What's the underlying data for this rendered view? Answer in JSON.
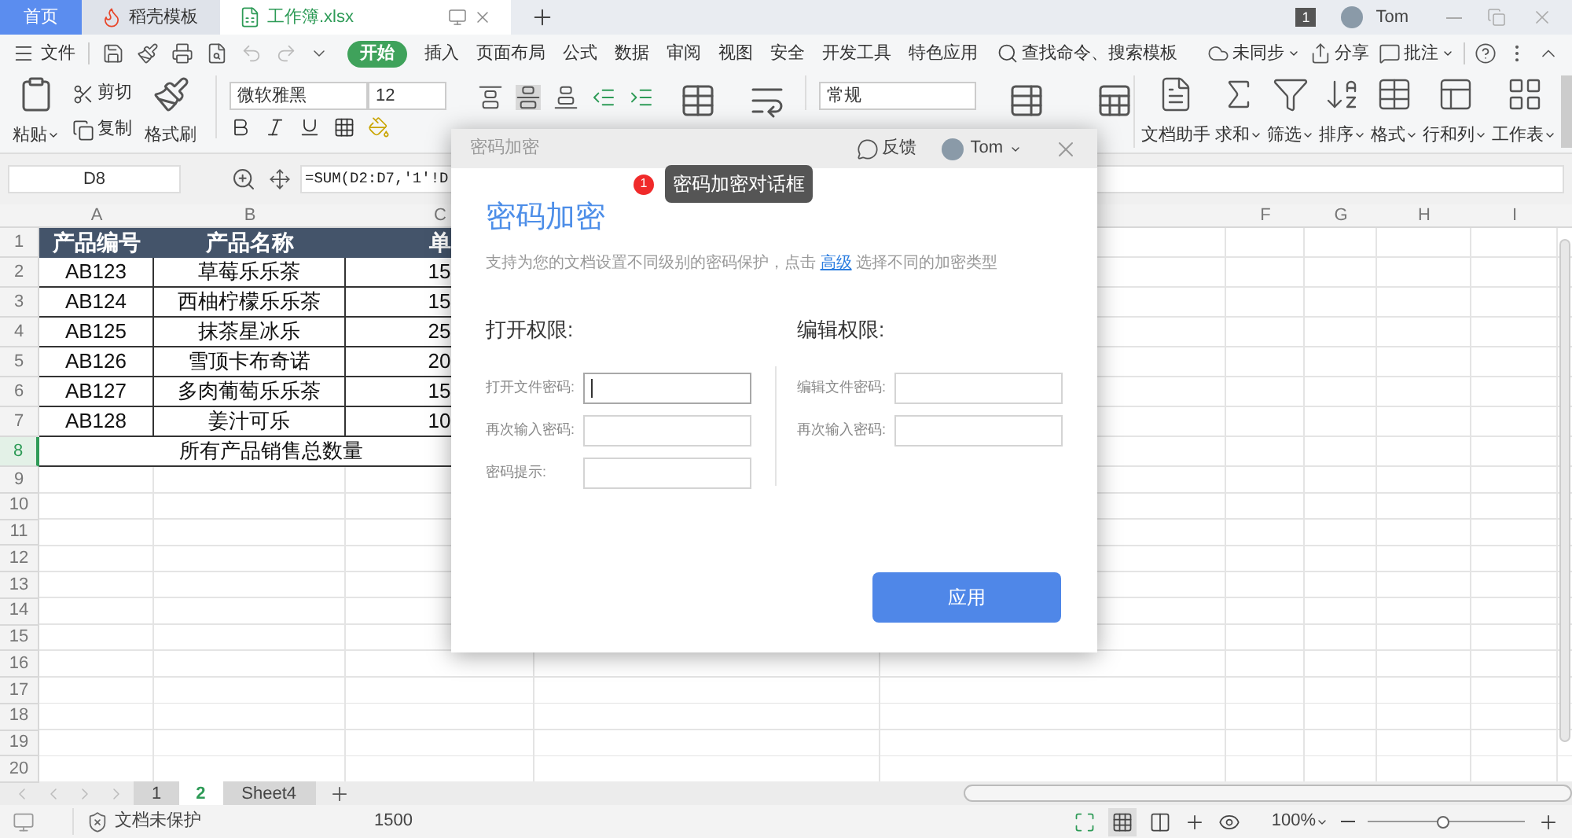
{
  "tabs": [
    {
      "label": "首页",
      "kind": "home",
      "selected": false
    },
    {
      "label": "稻壳模板",
      "kind": "docer",
      "selected": false
    },
    {
      "label": "工作簿.xlsx",
      "kind": "sheet",
      "selected": true
    }
  ],
  "title_bar": {
    "page_count": "1",
    "user": "Tom"
  },
  "menu": {
    "file": "文件",
    "items": [
      {
        "label": "开始",
        "selected": true
      },
      {
        "label": "插入",
        "selected": false
      },
      {
        "label": "页面布局",
        "selected": false
      },
      {
        "label": "公式",
        "selected": false
      },
      {
        "label": "数据",
        "selected": false
      },
      {
        "label": "审阅",
        "selected": false
      },
      {
        "label": "视图",
        "selected": false
      },
      {
        "label": "安全",
        "selected": false
      },
      {
        "label": "开发工具",
        "selected": false
      },
      {
        "label": "特色应用",
        "selected": false
      }
    ],
    "search": "查找命令、搜索模板",
    "right": [
      {
        "label": "未同步",
        "kind": "sync"
      },
      {
        "label": "分享",
        "kind": "share"
      },
      {
        "label": "批注",
        "kind": "comment"
      }
    ]
  },
  "ribbon": {
    "paste": "粘贴",
    "cut": "剪切",
    "copy": "复制",
    "format_painter": "格式刷",
    "font": "微软雅黑",
    "font_size": "12",
    "number_format": "常规",
    "tools": [
      {
        "label": "文档助手",
        "kind": "assistant"
      },
      {
        "label": "求和",
        "kind": "sum"
      },
      {
        "label": "筛选",
        "kind": "filter"
      },
      {
        "label": "排序",
        "kind": "sort"
      },
      {
        "label": "格式",
        "kind": "format"
      },
      {
        "label": "行和列",
        "kind": "rows"
      },
      {
        "label": "工作表",
        "kind": "sheet"
      }
    ]
  },
  "formula_bar": {
    "cell": "D8",
    "formula": "=SUM(D2:D7,'1'!D"
  },
  "sheet": {
    "columns": [
      "A",
      "B",
      "C",
      "F",
      "G",
      "H",
      "I"
    ],
    "rows": [
      {
        "number": "1",
        "kind": "header",
        "selected": false,
        "cells": [
          "产品编号",
          "产品名称",
          "单"
        ]
      },
      {
        "number": "2",
        "kind": "data",
        "selected": false,
        "cells": [
          "AB123",
          "草莓乐乐茶",
          "15"
        ]
      },
      {
        "number": "3",
        "kind": "data",
        "selected": false,
        "cells": [
          "AB124",
          "西柚柠檬乐乐茶",
          "15"
        ]
      },
      {
        "number": "4",
        "kind": "data",
        "selected": false,
        "cells": [
          "AB125",
          "抹茶星冰乐",
          "25"
        ]
      },
      {
        "number": "5",
        "kind": "data",
        "selected": false,
        "cells": [
          "AB126",
          "雪顶卡布奇诺",
          "20"
        ]
      },
      {
        "number": "6",
        "kind": "data",
        "selected": false,
        "cells": [
          "AB127",
          "多肉葡萄乐乐茶",
          "15"
        ]
      },
      {
        "number": "7",
        "kind": "data",
        "selected": false,
        "cells": [
          "AB128",
          "姜汁可乐",
          "10"
        ]
      },
      {
        "number": "8",
        "kind": "total",
        "selected": true,
        "cells": [
          "所有产品销售总数量"
        ]
      },
      {
        "number": "9",
        "kind": "empty",
        "selected": false
      },
      {
        "number": "10",
        "kind": "empty",
        "selected": false
      },
      {
        "number": "11",
        "kind": "empty",
        "selected": false
      },
      {
        "number": "12",
        "kind": "empty",
        "selected": false
      },
      {
        "number": "13",
        "kind": "empty",
        "selected": false
      },
      {
        "number": "14",
        "kind": "empty",
        "selected": false
      },
      {
        "number": "15",
        "kind": "empty",
        "selected": false
      },
      {
        "number": "16",
        "kind": "empty",
        "selected": false
      },
      {
        "number": "17",
        "kind": "empty",
        "selected": false
      },
      {
        "number": "18",
        "kind": "empty",
        "selected": false
      },
      {
        "number": "19",
        "kind": "empty",
        "selected": false
      },
      {
        "number": "20",
        "kind": "empty",
        "selected": false
      }
    ]
  },
  "sheet_tabs": [
    {
      "label": "1",
      "selected": false
    },
    {
      "label": "2",
      "selected": true
    },
    {
      "label": "Sheet4",
      "selected": false
    }
  ],
  "status_bar": {
    "protection": "文档未保护",
    "value": "1500",
    "zoom": "100%",
    "zoom_slider": {
      "level": 0.48
    }
  },
  "dialog": {
    "window_title": "密码加密",
    "feedback": "反馈",
    "user": "Tom",
    "heading": "密码加密",
    "description": "支持为您的文档设置不同级别的密码保护，点击",
    "link": "高级",
    "description_after": "选择不同的加密类型",
    "open_section": {
      "title": "打开权限:",
      "fields": [
        {
          "label": "打开文件密码:",
          "focused": true
        },
        {
          "label": "再次输入密码:",
          "focused": false
        },
        {
          "label": "密码提示:",
          "focused": false
        }
      ]
    },
    "edit_section": {
      "title": "编辑权限:",
      "fields": [
        {
          "label": "编辑文件密码:",
          "focused": false
        },
        {
          "label": "再次输入密码:",
          "focused": false
        }
      ]
    },
    "apply": "应用"
  },
  "callout": {
    "number": "1",
    "text": "密码加密对话框"
  }
}
